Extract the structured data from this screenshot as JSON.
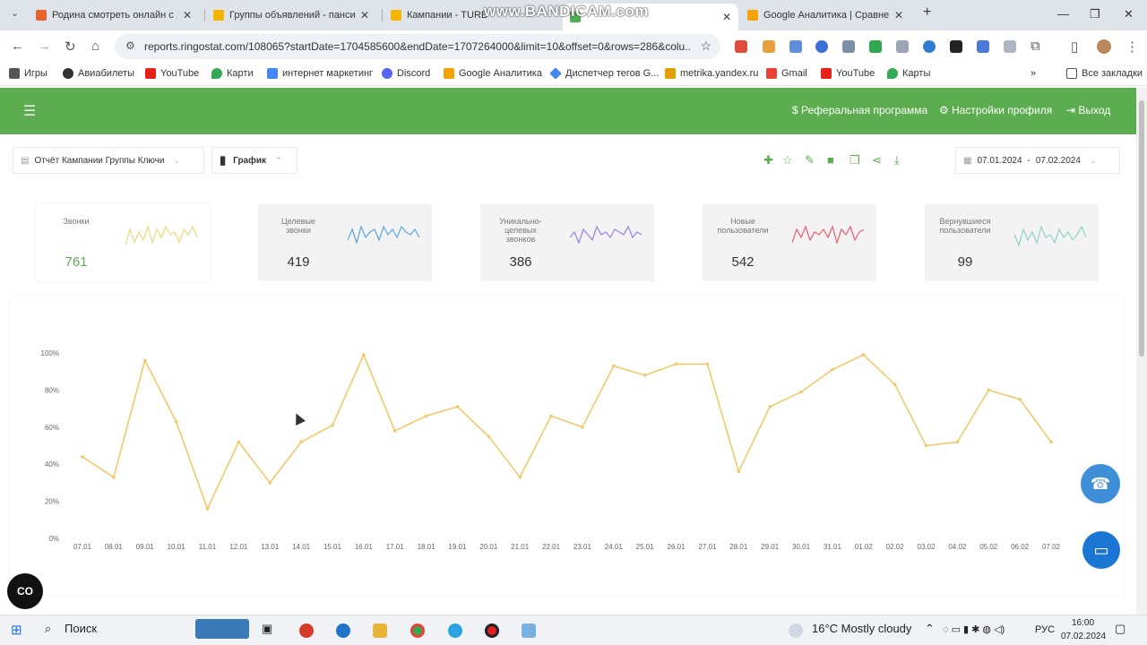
{
  "browser": {
    "tabs": [
      {
        "label": "Родина смотреть онлайн с 1 п",
        "color": "#e8632b"
      },
      {
        "label": "Группы объявлений - пансио",
        "color": "#f4b400"
      },
      {
        "label": "Кампании - TURB",
        "color": "#f4b400"
      },
      {
        "label": "",
        "color": "#4caf50"
      },
      {
        "label": "Google Аналитика | Сравнени",
        "color": "#f4a300"
      }
    ],
    "watermark": "www.BANDICAM.com",
    "url": "reports.ringostat.com/108065?startDate=1704585600&endDate=1707264000&limit=10&offset=0&rows=286&colu...",
    "bookmarks": [
      {
        "label": "Игры",
        "color": "#555"
      },
      {
        "label": "Авиабилеты",
        "color": "#333"
      },
      {
        "label": "YouTube",
        "color": "#e62117"
      },
      {
        "label": "Карти",
        "color": "#34a853"
      },
      {
        "label": "интернет маркетинг",
        "color": "#4285f4"
      },
      {
        "label": "Discord",
        "color": "#5865f2"
      },
      {
        "label": "Google Аналитика",
        "color": "#f4a300"
      },
      {
        "label": "Диспетчер тегов G...",
        "color": "#4285f4"
      },
      {
        "label": "metrika.yandex.ru",
        "color": "#e2a000"
      },
      {
        "label": "Gmail",
        "color": "#ea4335"
      },
      {
        "label": "YouTube",
        "color": "#e62117"
      },
      {
        "label": "Карты",
        "color": "#34a853"
      }
    ],
    "all_bookmarks": "Все закладки"
  },
  "app": {
    "header_links": {
      "referral": "$ Реферальная программа",
      "settings": "Настройки профиля",
      "logout": "Выход"
    },
    "report_select": "Отчёт Кампании Группы Ключи",
    "view_select": "График",
    "date_from": "07.01.2024",
    "date_sep": "-",
    "date_to": "07.02.2024",
    "accent": "#5cad4f"
  },
  "stats": [
    {
      "label": "Звонки",
      "value": "761",
      "color": "#f0d77a"
    },
    {
      "label": "Целевые звонки",
      "value": "419",
      "color": "#5aa6e0"
    },
    {
      "label": "Уникально-целевых звонков",
      "value": "386",
      "color": "#9b7fe6"
    },
    {
      "label": "Новые пользователи",
      "value": "542",
      "color": "#ec5b6e"
    },
    {
      "label": "Вернувшиеся пользователи",
      "value": "99",
      "color": "#8fd3c8"
    }
  ],
  "chart_data": {
    "type": "line",
    "categories": [
      "07.01",
      "08.01",
      "09.01",
      "10.01",
      "11.01",
      "12.01",
      "13.01",
      "14.01",
      "15.01",
      "16.01",
      "17.01",
      "18.01",
      "19.01",
      "20.01",
      "21.01",
      "22.01",
      "23.01",
      "24.01",
      "25.01",
      "26.01",
      "27.01",
      "28.01",
      "29.01",
      "30.01",
      "31.01",
      "01.02",
      "02.02",
      "03.02",
      "04.02",
      "05.02",
      "06.02",
      "07.02"
    ],
    "values": [
      44,
      33,
      96,
      63,
      16,
      52,
      30,
      52,
      61,
      99,
      58,
      66,
      71,
      55,
      33,
      66,
      60,
      93,
      88,
      94,
      94,
      36,
      71,
      79,
      91,
      99,
      83,
      50,
      52,
      80,
      75,
      52
    ],
    "ylim": [
      0,
      100
    ],
    "yticks": [
      "0%",
      "20%",
      "40%",
      "60%",
      "80%",
      "100%"
    ],
    "color": "#f0c96a"
  },
  "taskbar": {
    "search": "Поиск",
    "weather": "16°C  Mostly cloudy",
    "lang": "РУС",
    "time": "16:00",
    "date": "07.02.2024"
  }
}
